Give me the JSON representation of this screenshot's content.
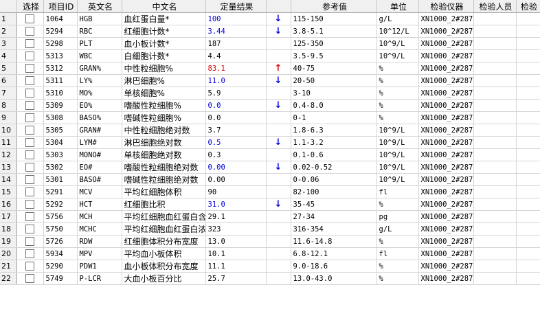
{
  "columns": {
    "row": "",
    "select": "选择",
    "item_id": "项目ID",
    "en_name": "英文名",
    "cn_name": "中文名",
    "result": "定量结果",
    "flag": "",
    "reference": "参考值",
    "unit": "单位",
    "instrument": "检验仪器",
    "tester": "检验人员",
    "verifier": "检验"
  },
  "colors": {
    "low": "#0000dd",
    "high": "#dd0000",
    "header_bg": "#f0f0f0"
  },
  "rows": [
    {
      "n": "1",
      "id": "1064",
      "en": "HGB",
      "cn": "血红蛋白量*",
      "result": "100",
      "status": "low",
      "flag": "↓",
      "ref": "115-150",
      "unit": "g/L",
      "instrument": "XN1000_2#28734"
    },
    {
      "n": "2",
      "id": "5294",
      "en": "RBC",
      "cn": "红细胞计数*",
      "result": "3.44",
      "status": "low",
      "flag": "↓",
      "ref": "3.8-5.1",
      "unit": "10^12/L",
      "instrument": "XN1000_2#28734"
    },
    {
      "n": "3",
      "id": "5298",
      "en": "PLT",
      "cn": "血小板计数*",
      "result": "187",
      "status": "normal",
      "flag": "",
      "ref": "125-350",
      "unit": "10^9/L",
      "instrument": "XN1000_2#28734"
    },
    {
      "n": "4",
      "id": "5313",
      "en": "WBC",
      "cn": "白细胞计数*",
      "result": "4.4",
      "status": "normal",
      "flag": "",
      "ref": "3.5-9.5",
      "unit": "10^9/L",
      "instrument": "XN1000_2#28734"
    },
    {
      "n": "5",
      "id": "5312",
      "en": "GRAN%",
      "cn": "中性粒细胞%",
      "result": "83.1",
      "status": "high",
      "flag": "↑",
      "ref": "40-75",
      "unit": "%",
      "instrument": "XN1000_2#28734"
    },
    {
      "n": "6",
      "id": "5311",
      "en": "LY%",
      "cn": "淋巴细胞%",
      "result": "11.0",
      "status": "low",
      "flag": "↓",
      "ref": "20-50",
      "unit": "%",
      "instrument": "XN1000_2#28734"
    },
    {
      "n": "7",
      "id": "5310",
      "en": "MO%",
      "cn": "单核细胞%",
      "result": "5.9",
      "status": "normal",
      "flag": "",
      "ref": "3-10",
      "unit": "%",
      "instrument": "XN1000_2#28734"
    },
    {
      "n": "8",
      "id": "5309",
      "en": "EO%",
      "cn": "嗜酸性粒细胞%",
      "result": "0.0",
      "status": "low",
      "flag": "↓",
      "ref": "0.4-8.0",
      "unit": "%",
      "instrument": "XN1000_2#28734"
    },
    {
      "n": "9",
      "id": "5308",
      "en": "BASO%",
      "cn": "嗜碱性粒细胞%",
      "result": "0.0",
      "status": "normal",
      "flag": "",
      "ref": "0-1",
      "unit": "%",
      "instrument": "XN1000_2#28734"
    },
    {
      "n": "10",
      "id": "5305",
      "en": "GRAN#",
      "cn": "中性粒细胞绝对数",
      "result": "3.7",
      "status": "normal",
      "flag": "",
      "ref": "1.8-6.3",
      "unit": "10^9/L",
      "instrument": "XN1000_2#28734"
    },
    {
      "n": "11",
      "id": "5304",
      "en": "LYM#",
      "cn": "淋巴细胞绝对数",
      "result": "0.5",
      "status": "low",
      "flag": "↓",
      "ref": "1.1-3.2",
      "unit": "10^9/L",
      "instrument": "XN1000_2#28734"
    },
    {
      "n": "12",
      "id": "5303",
      "en": "MONO#",
      "cn": "单核细胞绝对数",
      "result": "0.3",
      "status": "normal",
      "flag": "",
      "ref": "0.1-0.6",
      "unit": "10^9/L",
      "instrument": "XN1000_2#28734"
    },
    {
      "n": "13",
      "id": "5302",
      "en": "EO#",
      "cn": "嗜酸性粒细胞绝对数",
      "result": "0.00",
      "status": "low",
      "flag": "↓",
      "ref": "0.02-0.52",
      "unit": "10^9/L",
      "instrument": "XN1000_2#28734"
    },
    {
      "n": "14",
      "id": "5301",
      "en": "BASO#",
      "cn": "嗜碱性粒细胞绝对数",
      "result": "0.00",
      "status": "normal",
      "flag": "",
      "ref": "0-0.06",
      "unit": "10^9/L",
      "instrument": "XN1000_2#28734"
    },
    {
      "n": "15",
      "id": "5291",
      "en": "MCV",
      "cn": "平均红细胞体积",
      "result": "90",
      "status": "normal",
      "flag": "",
      "ref": "82-100",
      "unit": "fl",
      "instrument": "XN1000_2#28734"
    },
    {
      "n": "16",
      "id": "5292",
      "en": "HCT",
      "cn": "红细胞比积",
      "result": "31.0",
      "status": "low",
      "flag": "↓",
      "ref": "35-45",
      "unit": "%",
      "instrument": "XN1000_2#28734"
    },
    {
      "n": "17",
      "id": "5756",
      "en": "MCH",
      "cn": "平均红细胞血红蛋白含量",
      "result": "29.1",
      "status": "normal",
      "flag": "",
      "ref": "27-34",
      "unit": "pg",
      "instrument": "XN1000_2#28734"
    },
    {
      "n": "18",
      "id": "5750",
      "en": "MCHC",
      "cn": "平均红细胞血红蛋白浓度",
      "result": "323",
      "status": "normal",
      "flag": "",
      "ref": "316-354",
      "unit": "g/L",
      "instrument": "XN1000_2#28734"
    },
    {
      "n": "19",
      "id": "5726",
      "en": "RDW",
      "cn": "红细胞体积分布宽度",
      "result": "13.0",
      "status": "normal",
      "flag": "",
      "ref": "11.6-14.8",
      "unit": "%",
      "instrument": "XN1000_2#28734"
    },
    {
      "n": "20",
      "id": "5934",
      "en": "MPV",
      "cn": "平均血小板体积",
      "result": "10.1",
      "status": "normal",
      "flag": "",
      "ref": "6.8-12.1",
      "unit": "fl",
      "instrument": "XN1000_2#28734"
    },
    {
      "n": "21",
      "id": "5290",
      "en": "PDW1",
      "cn": "血小板体积分布宽度",
      "result": "11.1",
      "status": "normal",
      "flag": "",
      "ref": "9.0-18.6",
      "unit": "%",
      "instrument": "XN1000_2#28734"
    },
    {
      "n": "22",
      "id": "5749",
      "en": "P-LCR",
      "cn": "大血小板百分比",
      "result": "25.7",
      "status": "normal",
      "flag": "",
      "ref": "13.0-43.0",
      "unit": "%",
      "instrument": "XN1000_2#28734"
    }
  ]
}
